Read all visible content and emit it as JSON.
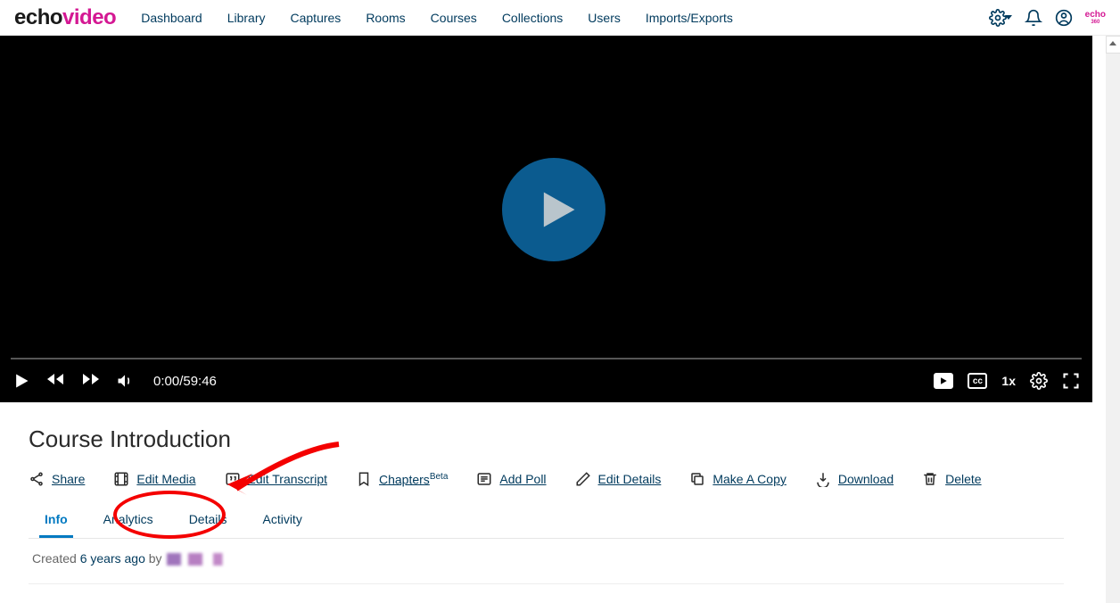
{
  "brand": {
    "part1": "echo",
    "part2": "video",
    "mini_main": "echo",
    "mini_sub": "360"
  },
  "nav": {
    "dashboard": "Dashboard",
    "library": "Library",
    "captures": "Captures",
    "rooms": "Rooms",
    "courses": "Courses",
    "collections": "Collections",
    "users": "Users",
    "imports_exports": "Imports/Exports"
  },
  "player": {
    "time_display": "0:00/59:46",
    "speed": "1x",
    "cc_label": "cc"
  },
  "media": {
    "title": "Course Introduction",
    "actions": {
      "share": "Share",
      "edit_media": "Edit Media",
      "edit_transcript": "Edit Transcript",
      "chapters": "Chapters",
      "chapters_badge": "Beta",
      "add_poll": "Add Poll",
      "edit_details": "Edit Details",
      "make_copy": "Make A Copy",
      "download": "Download",
      "delete": "Delete"
    }
  },
  "tabs": {
    "info": "Info",
    "analytics": "Analytics",
    "details": "Details",
    "activity": "Activity"
  },
  "info": {
    "created_prefix": "Created ",
    "created_ago": "6 years ago",
    "by": " by "
  }
}
